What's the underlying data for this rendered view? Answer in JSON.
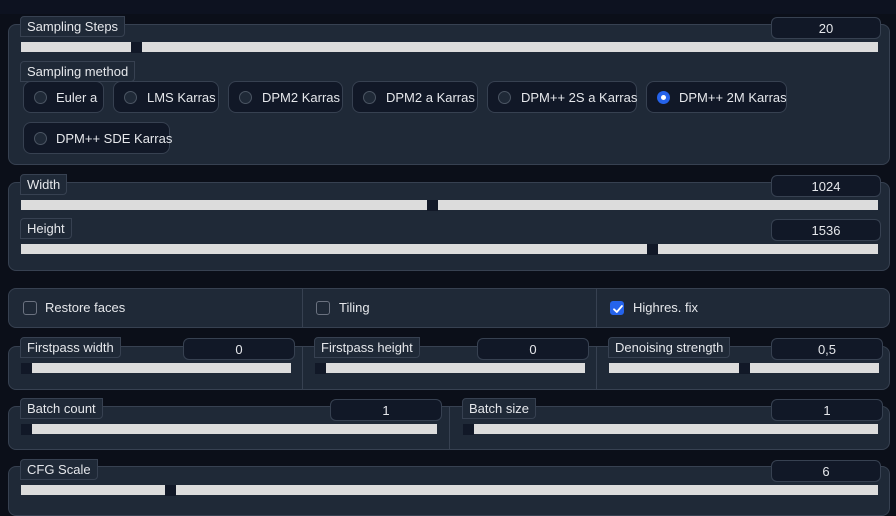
{
  "sampling_steps": {
    "label": "Sampling Steps",
    "value": "20",
    "fraction": 0.13
  },
  "sampling_method": {
    "label": "Sampling method",
    "options": [
      "Euler a",
      "LMS Karras",
      "DPM2 Karras",
      "DPM2 a Karras",
      "DPM++ 2S a Karras",
      "DPM++ 2M Karras",
      "DPM++ SDE Karras"
    ],
    "selected": "DPM++ 2M Karras"
  },
  "width": {
    "label": "Width",
    "value": "1024",
    "fraction": 0.48
  },
  "height": {
    "label": "Height",
    "value": "1536",
    "fraction": 0.74
  },
  "checkboxes": {
    "restore_faces": "Restore faces",
    "tiling": "Tiling",
    "highres_fix": "Highres. fix"
  },
  "firstpass_width": {
    "label": "Firstpass width",
    "value": "0",
    "fraction": 0.0
  },
  "firstpass_height": {
    "label": "Firstpass height",
    "value": "0",
    "fraction": 0.0
  },
  "denoising_strength": {
    "label": "Denoising strength",
    "value": "0,5",
    "fraction": 0.5
  },
  "batch_count": {
    "label": "Batch count",
    "value": "1",
    "fraction": 0.0
  },
  "batch_size": {
    "label": "Batch size",
    "value": "1",
    "fraction": 0.0
  },
  "cfg_scale": {
    "label": "CFG Scale",
    "value": "6",
    "fraction": 0.17
  },
  "colors": {
    "accent": "#2563eb",
    "panel": "#1f2937",
    "track": "#dcdcdc"
  }
}
